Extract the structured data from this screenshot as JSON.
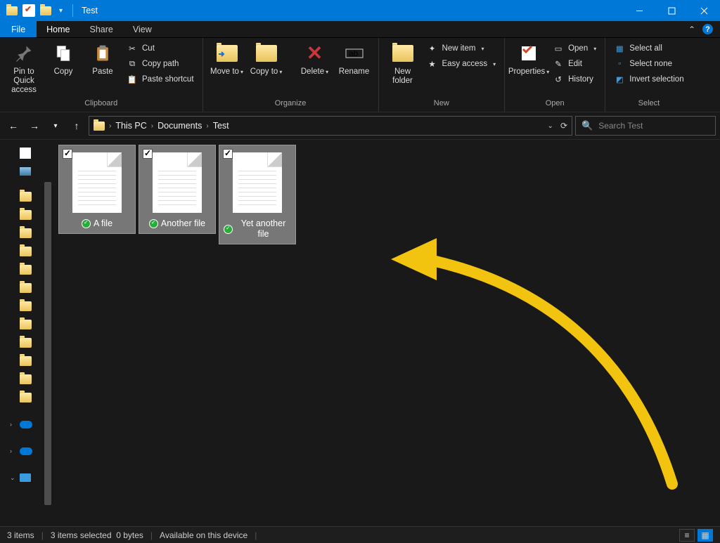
{
  "window": {
    "title": "Test"
  },
  "tabs": {
    "file": "File",
    "home": "Home",
    "share": "Share",
    "view": "View"
  },
  "ribbon": {
    "clipboard": {
      "label": "Clipboard",
      "pin": "Pin to Quick access",
      "copy": "Copy",
      "paste": "Paste",
      "cut": "Cut",
      "copy_path": "Copy path",
      "paste_shortcut": "Paste shortcut"
    },
    "organize": {
      "label": "Organize",
      "move_to": "Move to",
      "copy_to": "Copy to",
      "delete": "Delete",
      "rename": "Rename"
    },
    "new": {
      "label": "New",
      "new_folder": "New folder",
      "new_item": "New item",
      "easy_access": "Easy access"
    },
    "open": {
      "label": "Open",
      "properties": "Properties",
      "open": "Open",
      "edit": "Edit",
      "history": "History"
    },
    "select": {
      "label": "Select",
      "select_all": "Select all",
      "select_none": "Select none",
      "invert": "Invert selection"
    }
  },
  "breadcrumb": {
    "segments": [
      "This PC",
      "Documents",
      "Test"
    ]
  },
  "search": {
    "placeholder": "Search Test"
  },
  "files": [
    {
      "name": "A file"
    },
    {
      "name": "Another file"
    },
    {
      "name": "Yet another file"
    }
  ],
  "status": {
    "count": "3 items",
    "selected": "3 items selected",
    "size": "0 bytes",
    "availability": "Available on this device"
  }
}
